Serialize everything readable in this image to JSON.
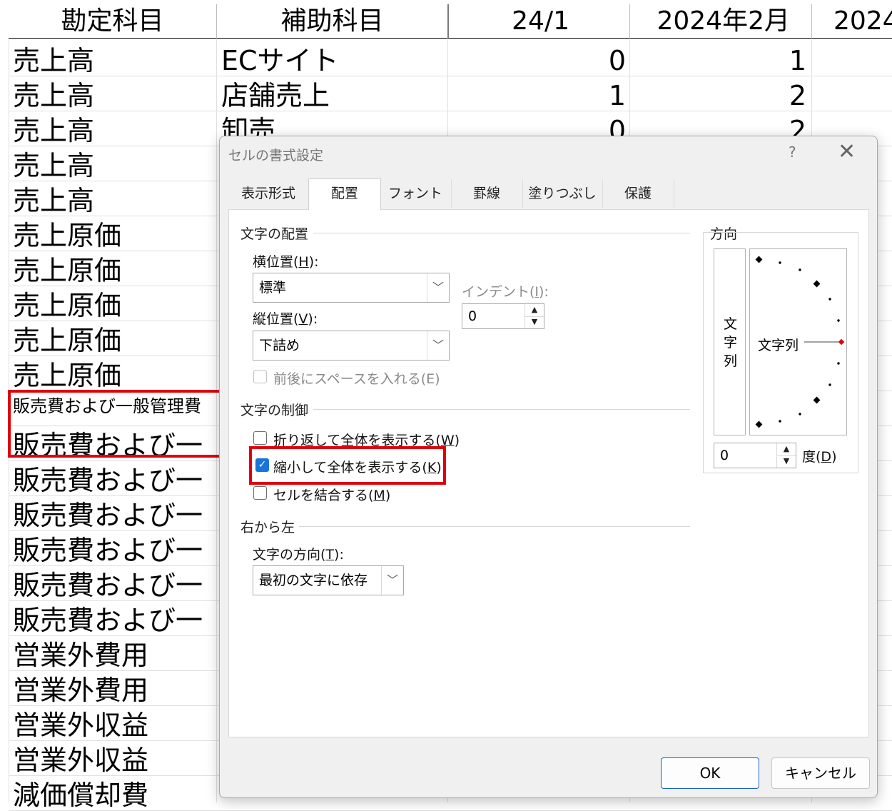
{
  "sheet": {
    "headers": [
      "勘定科目",
      "補助科目",
      "24/1",
      "2024年2月",
      "2024"
    ],
    "rows": [
      {
        "account": "売上高",
        "sub": "ECサイト",
        "v1": "0",
        "v2": "1"
      },
      {
        "account": "売上高",
        "sub": "店舗売上",
        "v1": "1",
        "v2": "2"
      },
      {
        "account": "売上高",
        "sub": "卸売",
        "v1": "0",
        "v2": "2"
      },
      {
        "account": "売上高",
        "sub": "",
        "v1": "",
        "v2": ""
      },
      {
        "account": "売上高",
        "sub": "",
        "v1": "",
        "v2": ""
      },
      {
        "account": "売上原価",
        "sub": "",
        "v1": "",
        "v2": ""
      },
      {
        "account": "売上原価",
        "sub": "",
        "v1": "",
        "v2": ""
      },
      {
        "account": "売上原価",
        "sub": "",
        "v1": "",
        "v2": ""
      },
      {
        "account": "売上原価",
        "sub": "",
        "v1": "",
        "v2": ""
      },
      {
        "account": "売上原価",
        "sub": "",
        "v1": "",
        "v2": ""
      },
      {
        "account": "販売費および一般管理費",
        "sub": "",
        "v1": "",
        "v2": "",
        "shrunk": true
      },
      {
        "account": "販売費および一",
        "sub": "",
        "v1": "",
        "v2": ""
      },
      {
        "account": "販売費および一",
        "sub": "",
        "v1": "",
        "v2": ""
      },
      {
        "account": "販売費および一",
        "sub": "",
        "v1": "",
        "v2": ""
      },
      {
        "account": "販売費および一",
        "sub": "",
        "v1": "",
        "v2": ""
      },
      {
        "account": "販売費および一",
        "sub": "",
        "v1": "",
        "v2": ""
      },
      {
        "account": "販売費および一",
        "sub": "",
        "v1": "",
        "v2": ""
      },
      {
        "account": "営業外費用",
        "sub": "",
        "v1": "",
        "v2": ""
      },
      {
        "account": "営業外費用",
        "sub": "",
        "v1": "",
        "v2": ""
      },
      {
        "account": "営業外収益",
        "sub": "",
        "v1": "",
        "v2": ""
      },
      {
        "account": "営業外収益",
        "sub": "",
        "v1": "",
        "v2": ""
      },
      {
        "account": "減価償却費",
        "sub": "",
        "v1": "",
        "v2": ""
      }
    ]
  },
  "dialog": {
    "title": "セルの書式設定",
    "help": "?",
    "close": "✕",
    "tabs": [
      "表示形式",
      "配置",
      "フォント",
      "罫線",
      "塗りつぶし",
      "保護"
    ],
    "active_tab": "配置",
    "text_alignment": {
      "section": "文字の配置",
      "horizontal_label": "横位置(",
      "horizontal_key": "H",
      "horizontal_value": "標準",
      "vertical_label": "縦位置(",
      "vertical_key": "V",
      "vertical_value": "下詰め",
      "indent_label": "インデント(",
      "indent_key": "I",
      "indent_value": "0",
      "justify_distributed": "前後にスペースを入れる(E)"
    },
    "text_control": {
      "section": "文字の制御",
      "wrap_label": "折り返して全体を表示する(",
      "wrap_key": "W",
      "wrap_checked": false,
      "shrink_label": "縮小して全体を表示する(",
      "shrink_key": "K",
      "shrink_checked": true,
      "merge_label": "セルを結合する(",
      "merge_key": "M",
      "merge_checked": false
    },
    "rtl": {
      "section": "右から左",
      "direction_label": "文字の方向(",
      "direction_key": "T",
      "direction_value": "最初の文字に依存"
    },
    "orientation": {
      "section": "方向",
      "vertical_text": [
        "文",
        "字",
        "列"
      ],
      "dial_text": "文字列",
      "degrees_value": "0",
      "degrees_label": "度(",
      "degrees_key": "D"
    },
    "ok": "OK",
    "cancel": "キャンセル",
    "colors": {
      "highlight": "#e0000c",
      "accent": "#1a73d8"
    }
  }
}
